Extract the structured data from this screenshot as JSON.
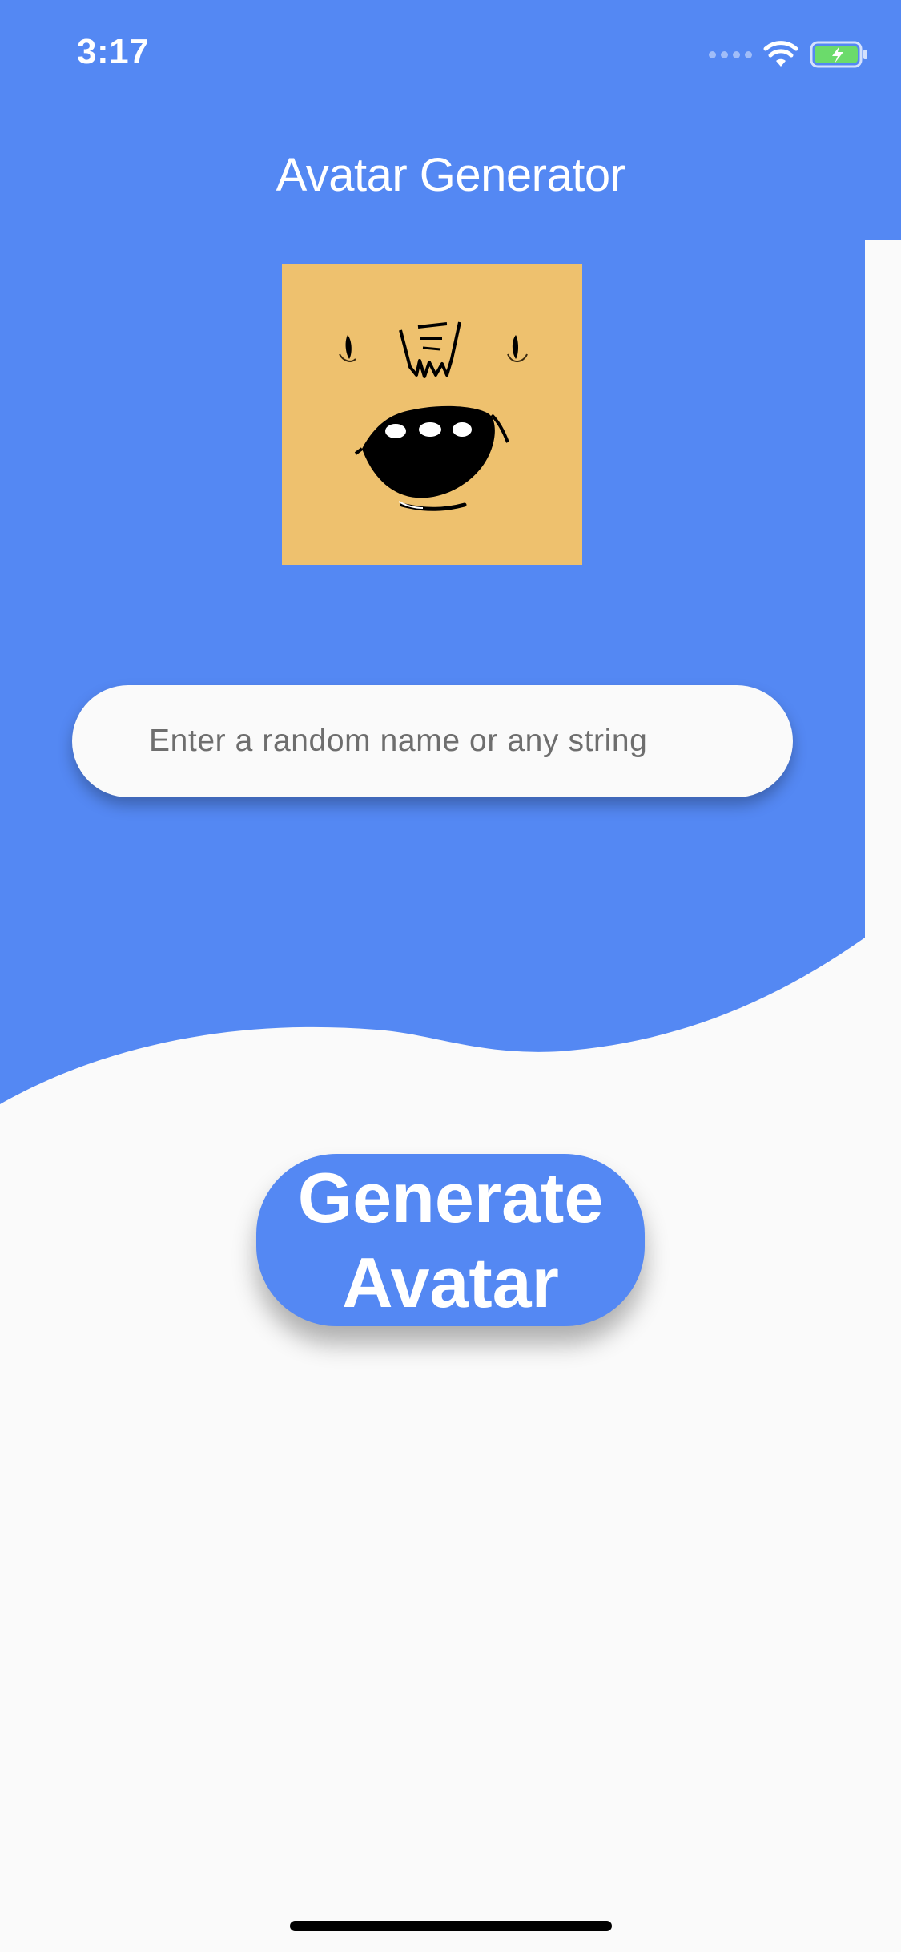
{
  "status_bar": {
    "time": "3:17"
  },
  "app_bar": {
    "title": "Avatar Generator"
  },
  "avatar": {
    "icon": "avatar-face-icon",
    "background_color": "#EEC16E"
  },
  "input": {
    "placeholder": "Enter a random name or any string",
    "value": ""
  },
  "button": {
    "line1": "Generate",
    "line2": "Avatar"
  },
  "colors": {
    "primary": "#5488F3",
    "background": "#FAFAFA",
    "battery": "#6BDB6B"
  }
}
